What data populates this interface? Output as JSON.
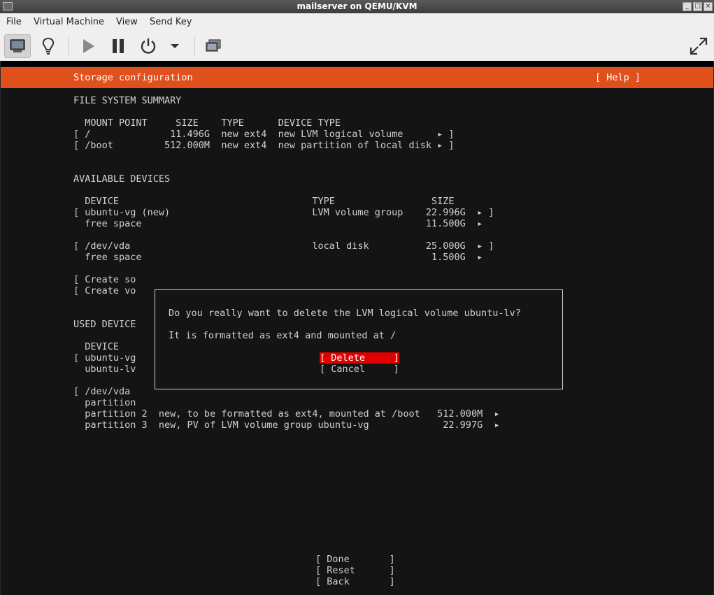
{
  "window": {
    "title": "mailserver on QEMU/KVM",
    "controls": [
      "_",
      "□",
      "×"
    ]
  },
  "menu": [
    "File",
    "Virtual Machine",
    "View",
    "Send Key"
  ],
  "toolbar": {
    "items": [
      "console-icon",
      "lightbulb-icon",
      "play-icon",
      "pause-icon",
      "power-icon",
      "dropdown-arrow-icon",
      "screenshot-icon",
      "fullscreen-icon"
    ]
  },
  "installer": {
    "header_title": "Storage configuration",
    "help": "[ Help ]",
    "fs_summary": {
      "heading": "FILE SYSTEM SUMMARY",
      "columns": "  MOUNT POINT     SIZE    TYPE      DEVICE TYPE",
      "rows": [
        "[ /              11.496G  new ext4  new LVM logical volume      ▸ ]",
        "[ /boot         512.000M  new ext4  new partition of local disk ▸ ]"
      ]
    },
    "available": {
      "heading": "AVAILABLE DEVICES",
      "columns": "  DEVICE                                  TYPE                 SIZE",
      "rows": [
        "[ ubuntu-vg (new)                         LVM volume group    22.996G  ▸ ]",
        "  free space                                                  11.500G  ▸",
        "[ /dev/vda                                local disk          25.000G  ▸ ]",
        "  free space                                                   1.500G  ▸"
      ],
      "create_rows": [
        "[ Create so",
        "[ Create vo"
      ]
    },
    "used": {
      "heading": "USED DEVICE",
      "columns": "  DEVICE",
      "rows": [
        "[ ubuntu-vg",
        "  ubuntu-lv"
      ],
      "vda": "[ /dev/vda",
      "partition": "  partition",
      "partition_rows": [
        "  partition 2  new, to be formatted as ext4, mounted at /boot   512.000M  ▸",
        "  partition 3  new, PV of LVM volume group ubuntu-vg             22.997G  ▸"
      ]
    },
    "dialog": {
      "line1": "Do you really want to delete the LVM logical volume ubuntu-lv?",
      "line2": "It is formatted as ext4 and mounted at /",
      "delete": "[ Delete     ]",
      "cancel": "[ Cancel     ]"
    },
    "footer": {
      "done": "[ Done       ]",
      "reset": "[ Reset      ]",
      "back": "[ Back       ]"
    }
  }
}
